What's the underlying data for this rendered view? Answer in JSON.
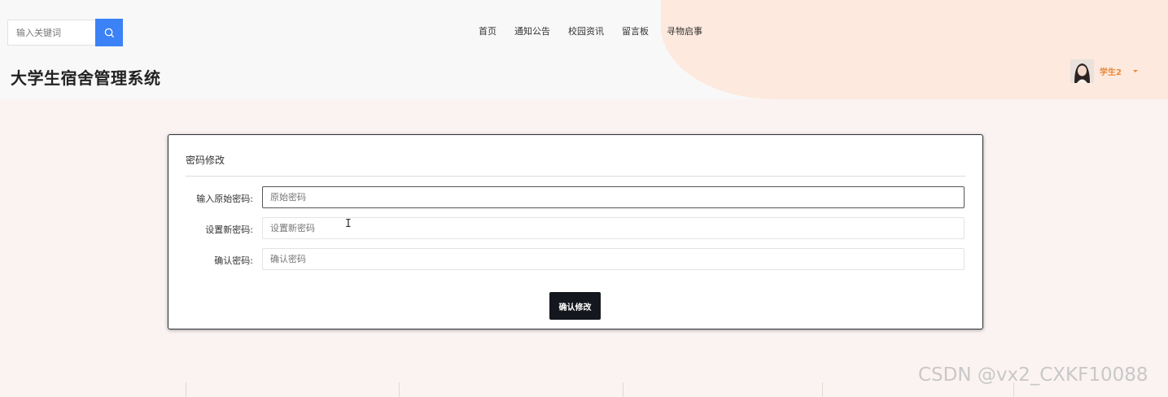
{
  "header": {
    "search": {
      "placeholder": "输入关键词"
    },
    "nav": [
      {
        "label": "首页"
      },
      {
        "label": "通知公告"
      },
      {
        "label": "校园资讯"
      },
      {
        "label": "留言板"
      },
      {
        "label": "寻物启事"
      }
    ],
    "site_title": "大学生宿舍管理系统",
    "user": {
      "name": "学生2"
    }
  },
  "panel": {
    "title": "密码修改",
    "fields": [
      {
        "label": "输入原始密码:",
        "placeholder": "原始密码",
        "value": ""
      },
      {
        "label": "设置新密码:",
        "placeholder": "设置新密码",
        "value": ""
      },
      {
        "label": "确认密码:",
        "placeholder": "确认密码",
        "value": ""
      }
    ],
    "submit_label": "确认修改"
  },
  "watermark": "CSDN @vx2_CXKF10088",
  "colors": {
    "accent_blue": "#3b82f6",
    "user_orange": "#e8883a",
    "button_dark": "#14171d"
  }
}
